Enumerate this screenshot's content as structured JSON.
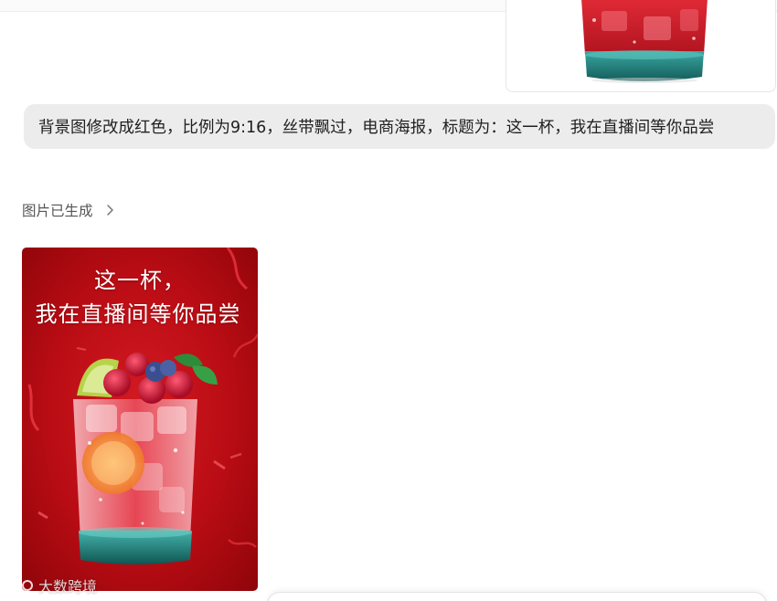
{
  "conversation": {
    "user_message": "背景图修改成红色，比例为9:16，丝带飘过，电商海报，标题为：这一杯，我在直播间等你品尝",
    "generated_status": "图片已生成",
    "generated_chevron_icon": "chevron-right-icon"
  },
  "poster": {
    "title_line1": "这一杯，",
    "title_line2": "我在直播间等你品尝",
    "background_color": "#c0101a",
    "drink": "red fruit drink with raspberries, blueberries, lime and mint"
  },
  "watermark": {
    "text": "大数跨境",
    "logo_icon": "watermark-logo-icon"
  },
  "colors": {
    "bubble_bg": "#ececec",
    "status_text": "#555555",
    "poster_red": "#c0101a",
    "glass_teal": "#1f7f7c"
  }
}
